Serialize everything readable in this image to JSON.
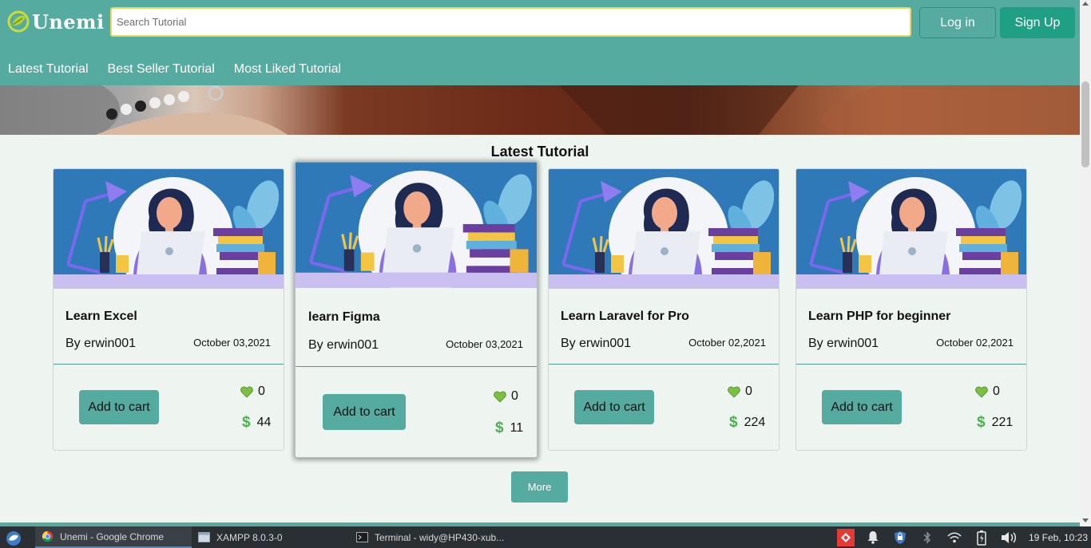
{
  "app": {
    "name": "Unemi"
  },
  "search": {
    "placeholder": "Search Tutorial"
  },
  "auth": {
    "login_label": "Log in",
    "signup_label": "Sign Up"
  },
  "nav": {
    "items": [
      {
        "label": "Latest Tutorial"
      },
      {
        "label": "Best Seller Tutorial"
      },
      {
        "label": "Most Liked Tutorial"
      }
    ]
  },
  "section": {
    "title": "Latest Tutorial"
  },
  "cards": [
    {
      "title": "Learn Excel",
      "author": "By erwin001",
      "date": "October 03,2021",
      "button": "Add to cart",
      "likes": "0",
      "price": "44"
    },
    {
      "title": "learn Figma",
      "author": "By erwin001",
      "date": "October 03,2021",
      "button": "Add to cart",
      "likes": "0",
      "price": "11"
    },
    {
      "title": "Learn Laravel for Pro",
      "author": "By erwin001",
      "date": "October 02,2021",
      "button": "Add to cart",
      "likes": "0",
      "price": "224"
    },
    {
      "title": "Learn PHP for beginner",
      "author": "By erwin001",
      "date": "October 02,2021",
      "button": "Add to cart",
      "likes": "0",
      "price": "221"
    }
  ],
  "more_label": "More",
  "colors": {
    "header": "#55ab9f",
    "accent": "#1f9f83",
    "background": "#eef5f1",
    "search_border": "#e8d95a"
  },
  "taskbar": {
    "tasks": [
      {
        "label": "Unemi - Google Chrome",
        "icon": "chrome-icon"
      },
      {
        "label": "XAMPP 8.0.3-0",
        "icon": "window-icon"
      },
      {
        "label": "Terminal - widy@HP430-xub...",
        "icon": "terminal-icon"
      }
    ],
    "clock": "19 Feb, 10:23"
  }
}
